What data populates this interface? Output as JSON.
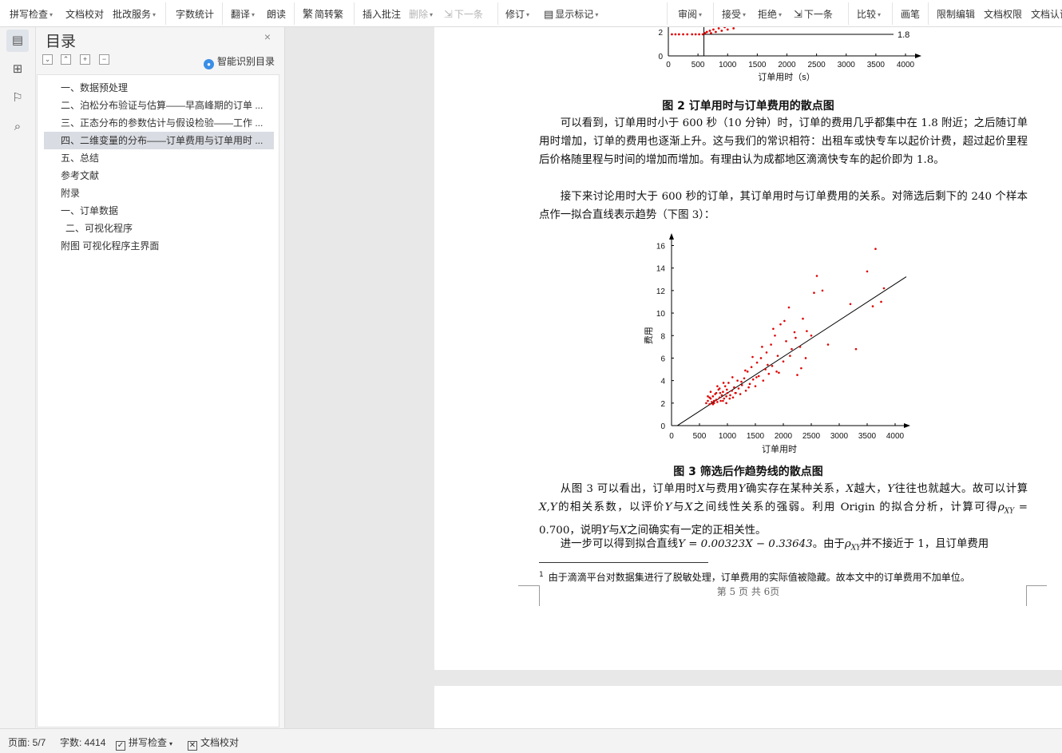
{
  "toolbar": {
    "spell_check": "拼写检查",
    "doc_proofread": "文档校对",
    "review_service": "批改服务",
    "word_count": "字数统计",
    "translate": "翻译",
    "read_aloud": "朗读",
    "simp_trad": "简转繁",
    "insert_comment": "插入批注",
    "delete": "删除",
    "next": "下一条",
    "track_changes": "修订",
    "show_markup": "显示标记",
    "review": "审阅",
    "accept": "接受",
    "reject": "拒绝",
    "next2": "下一条",
    "compare": "比较",
    "ink": "画笔",
    "restrict_edit": "限制编辑",
    "doc_rights": "文档权限",
    "doc_cert": "文档认证"
  },
  "toc": {
    "title": "目录",
    "smart_label": "智能识别目录",
    "items": [
      {
        "label": "一、数据预处理",
        "active": false
      },
      {
        "label": "二、泊松分布验证与估算——早高峰期的订单 ...",
        "active": false
      },
      {
        "label": "三、正态分布的参数估计与假设检验——工作 ...",
        "active": false
      },
      {
        "label": "四、二维变量的分布——订单费用与订单用时 ...",
        "active": true
      },
      {
        "label": "五、总结",
        "active": false
      },
      {
        "label": "参考文献",
        "active": false
      },
      {
        "label": "附录",
        "active": false
      },
      {
        "label": "一、订单数据",
        "active": false
      },
      {
        "label": "二、可视化程序",
        "active": false
      },
      {
        "label": "附图    可视化程序主界面",
        "active": false
      }
    ]
  },
  "document": {
    "fig2_caption": "图 2   订单用时与订单费用的散点图",
    "para1": "可以看到，订单用时小于 600 秒（10 分钟）时，订单的费用几乎都集中在 1.8 附近；之后随订单用时增加，订单的费用也逐渐上升。这与我们的常识相符：出租车或快专车以起价计费，超过起价里程后价格随里程与时间的增加而增加。有理由认为成都地区滴滴快专车的起价即为 1.8。",
    "para2": "接下来讨论用时大于 600 秒的订单，其订单用时与订单费用的关系。对筛选后剩下的 240 个样本点作一拟合直线表示趋势（下图 3）：",
    "fig3_caption": "图 3   筛选后作趋势线的散点图",
    "para3_a": "从图 3 可以看出，订单用时",
    "para3_b": "与费用",
    "para3_c": "确实存在某种关系，",
    "para3_d": "越大，",
    "para3_e": "往往也就越大。故可以计算",
    "para3_f": "的相关系数，以评价",
    "para3_g": "与",
    "para3_h": "之间线性关系的强弱。利用 Origin 的拟合分析，计算可得",
    "para3_i": "，说明",
    "para3_j": "之间确实有一定的正相关性。",
    "sym_X": "X",
    "sym_Y": "Y",
    "sym_XY": "X,Y",
    "sym_rho": "ρ",
    "sym_rho_sub": "XY",
    "rho_value": " = 0.700",
    "para4_a": "进一步可以得到拟合直线",
    "para4_eq": "Y = 0.00323X − 0.33643",
    "para4_b": "。由于",
    "para4_c": "并不接近于 1，且订单费用",
    "footnote": "由于滴滴平台对数据集进行了脱敏处理，订单费用的实际值被隐藏。故本文中的订单费用不加单位。",
    "footnote_mark": "1",
    "page_number": "第 5 页 共 6页"
  },
  "chart_data": [
    {
      "type": "scatter",
      "title": "",
      "xlabel": "订单用时（s）",
      "ylabel": "",
      "xlim": [
        0,
        4000
      ],
      "xticks": [
        "0",
        "500",
        "1000",
        "1500",
        "2000",
        "2500",
        "3000",
        "3500",
        "4000"
      ],
      "yticks_visible": [
        "0",
        "2"
      ],
      "annotation": "1.8",
      "reference_line_y": 1.8,
      "series": [
        {
          "color": "#e00000",
          "x": [
            60,
            120,
            180,
            250,
            320,
            400,
            460,
            520,
            580,
            620,
            650,
            700,
            720,
            760,
            800,
            850,
            900,
            950,
            1000,
            1050,
            1100,
            1200,
            1400
          ],
          "y": [
            1.8,
            1.8,
            1.8,
            1.8,
            1.8,
            1.8,
            1.8,
            1.8,
            1.8,
            1.9,
            2.0,
            2.1,
            1.9,
            2.2,
            2.0,
            2.3,
            2.1,
            2.4,
            2.2,
            2.5,
            2.3,
            2.6,
            2.8
          ]
        }
      ]
    },
    {
      "type": "scatter",
      "title": "",
      "xlabel": "订单用时",
      "ylabel": "费用",
      "xlim": [
        0,
        4000
      ],
      "ylim": [
        0,
        17
      ],
      "xticks": [
        "0",
        "500",
        "1000",
        "1500",
        "2000",
        "2500",
        "3000",
        "3500",
        "4000"
      ],
      "yticks": [
        "0",
        "2",
        "4",
        "6",
        "8",
        "10",
        "12",
        "14",
        "16"
      ],
      "trendline": {
        "slope": 0.00323,
        "intercept": -0.33643,
        "color": "#000000"
      },
      "series": [
        {
          "color": "#e00000",
          "x": [
            620,
            650,
            680,
            700,
            720,
            740,
            760,
            780,
            800,
            820,
            840,
            860,
            880,
            900,
            920,
            940,
            960,
            980,
            1000,
            1020,
            1050,
            1080,
            1100,
            1120,
            1150,
            1180,
            1200,
            1230,
            1260,
            1300,
            1330,
            1360,
            1400,
            1430,
            1460,
            1500,
            1530,
            1560,
            1600,
            1640,
            1680,
            1700,
            1740,
            1780,
            1800,
            1850,
            1880,
            1900,
            1950,
            2000,
            2050,
            2100,
            2150,
            2200,
            2250,
            2300,
            2350,
            2400,
            2500,
            2550,
            2600,
            2700,
            2800,
            3200,
            3300,
            3500,
            3600,
            3650,
            3750,
            3800,
            650,
            700,
            760,
            820,
            870,
            930,
            990,
            1040,
            1090,
            1140,
            1250,
            1320,
            1380,
            1450,
            1520,
            1620,
            1720,
            1820,
            1920,
            2020,
            2120,
            2220,
            2320,
            2420,
            680,
            740,
            800,
            860,
            920,
            980
          ],
          "y": [
            2.0,
            2.2,
            1.9,
            2.4,
            2.1,
            2.6,
            2.0,
            2.8,
            2.3,
            2.1,
            3.2,
            2.5,
            2.2,
            2.7,
            3.0,
            2.4,
            3.5,
            2.6,
            2.9,
            3.8,
            2.7,
            3.1,
            2.5,
            3.4,
            2.9,
            4.0,
            3.3,
            2.8,
            3.6,
            4.2,
            3.1,
            4.8,
            3.7,
            5.2,
            4.1,
            3.5,
            5.6,
            4.4,
            6.0,
            4.0,
            5.0,
            6.5,
            4.6,
            7.2,
            5.3,
            8.0,
            4.8,
            6.2,
            9.0,
            5.7,
            7.5,
            10.5,
            6.8,
            8.3,
            4.5,
            7.0,
            9.5,
            6.0,
            8.0,
            11.8,
            13.3,
            12.0,
            7.2,
            10.8,
            6.8,
            13.7,
            10.6,
            15.7,
            11.0,
            12.2,
            2.6,
            3.0,
            2.2,
            3.5,
            2.9,
            3.8,
            3.2,
            2.4,
            4.3,
            2.9,
            3.9,
            4.9,
            3.4,
            6.1,
            4.3,
            7.0,
            5.4,
            8.6,
            4.7,
            9.3,
            6.2,
            7.8,
            5.1,
            8.4,
            2.5,
            1.9,
            2.9,
            3.3,
            2.2,
            2.0
          ]
        }
      ]
    }
  ],
  "status": {
    "page": "页面: 5/7",
    "words": "字数: 4414",
    "spell": "拼写检查",
    "proof": "文档校对"
  }
}
